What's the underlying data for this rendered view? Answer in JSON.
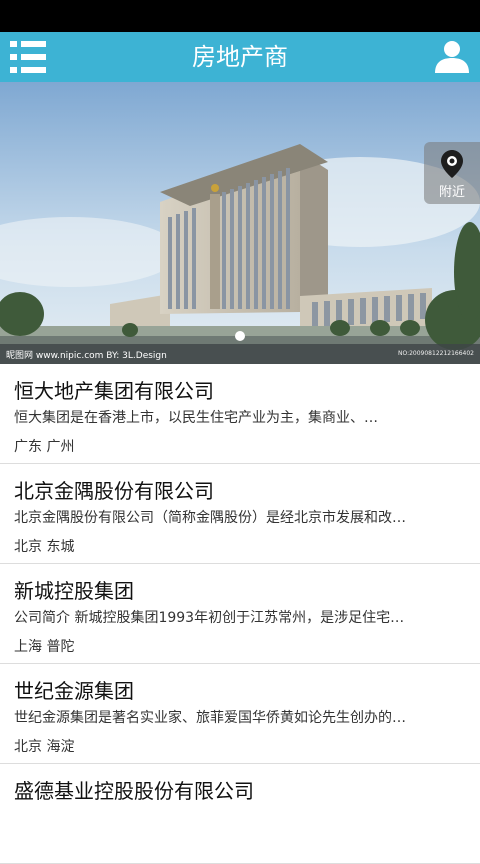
{
  "header": {
    "title": "房地产商",
    "menu_icon": "list-menu-icon",
    "user_icon": "user-profile-icon"
  },
  "banner": {
    "nearby_label": "附近",
    "nearby_icon": "location-pin-icon",
    "watermark_left": "昵图网 www.nipic.com   BY: 3L.Design",
    "watermark_right": "NO:20090812212166402"
  },
  "companies": [
    {
      "name": "恒大地产集团有限公司",
      "desc": "恒大集团是在香港上市，以民生住宅产业为主，集商业、…",
      "location": "广东  广州"
    },
    {
      "name": "北京金隅股份有限公司",
      "desc": "北京金隅股份有限公司（简称金隅股份）是经北京市发展和改…",
      "location": "北京  东城"
    },
    {
      "name": "新城控股集团",
      "desc": "公司简介 新城控股集团1993年初创于江苏常州，是涉足住宅…",
      "location": "上海  普陀"
    },
    {
      "name": "世纪金源集团",
      "desc": "世纪金源集团是著名实业家、旅菲爱国华侨黄如论先生创办的…",
      "location": "北京  海淀"
    },
    {
      "name": "盛德基业控股股份有限公司",
      "desc": "",
      "location": ""
    }
  ],
  "colors": {
    "header": "#3db3d4",
    "status_bar": "#000000"
  }
}
